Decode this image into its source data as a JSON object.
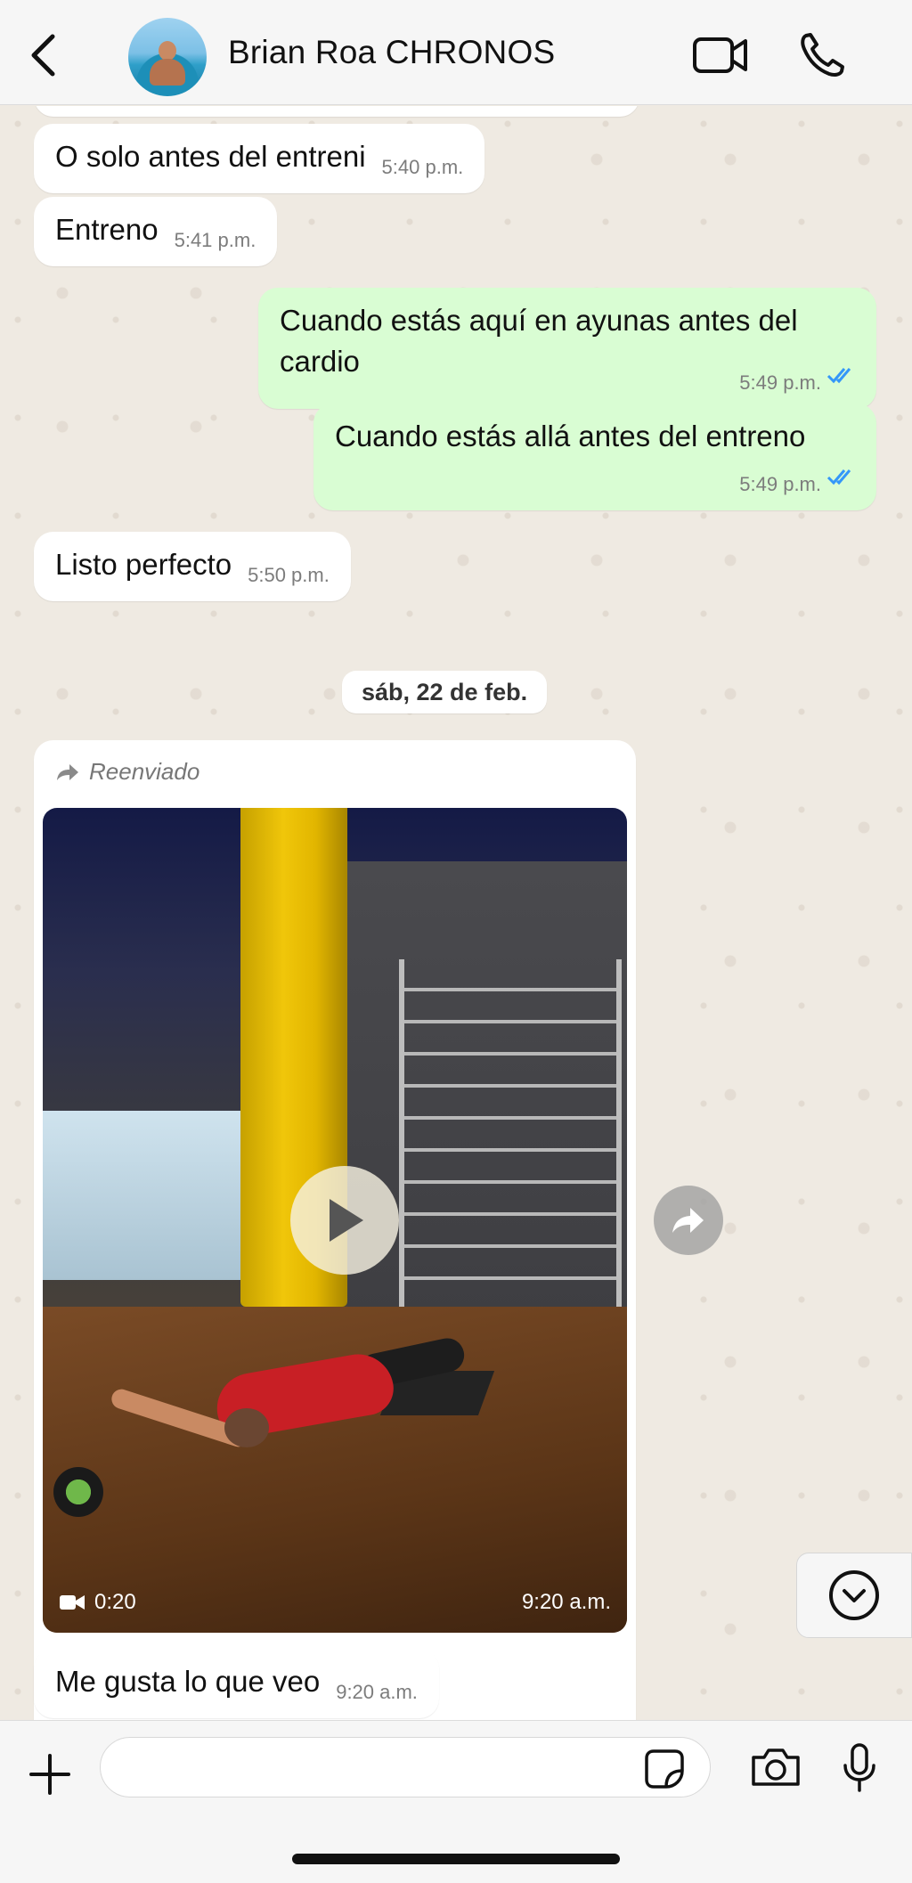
{
  "header": {
    "contact_name": "Brian Roa CHRONOS"
  },
  "messages": [
    {
      "id": "m1",
      "direction": "in",
      "text": "O solo antes del entreni",
      "time": "5:40 p.m."
    },
    {
      "id": "m2",
      "direction": "in",
      "text": "Entreno",
      "time": "5:41 p.m."
    },
    {
      "id": "m3",
      "direction": "out",
      "text_line1": "Cuando estás aquí en ayunas antes del",
      "text_line2": "cardio",
      "time": "5:49 p.m.",
      "status": "read"
    },
    {
      "id": "m4",
      "direction": "out",
      "text": "Cuando estás allá antes del entreno",
      "time": "5:49 p.m.",
      "status": "read"
    },
    {
      "id": "m5",
      "direction": "in",
      "text": "Listo perfecto",
      "time": "5:50 p.m."
    }
  ],
  "date_separator": "sáb, 22 de feb.",
  "media_message": {
    "forwarded_label": "Reenviado",
    "video_duration": "0:20",
    "time": "9:20 a.m."
  },
  "last_message": {
    "direction": "in",
    "text": "Me gusta lo que veo",
    "time": "9:20 a.m."
  },
  "composer": {
    "placeholder": ""
  },
  "colors": {
    "incoming_bubble": "#ffffff",
    "outgoing_bubble": "#d9fdd3",
    "chat_background": "#efeae2",
    "read_tick": "#3497f9"
  }
}
